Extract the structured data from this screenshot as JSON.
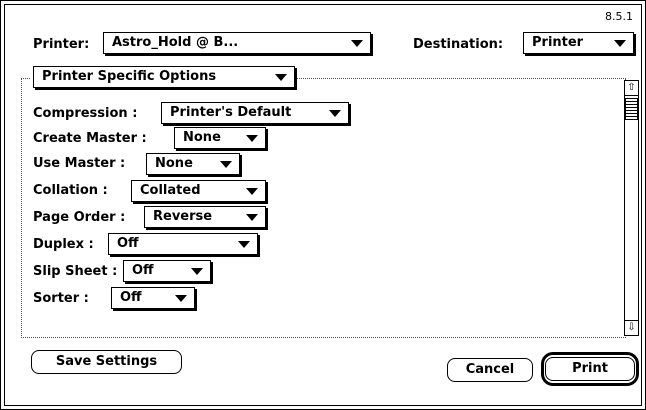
{
  "version": "8.5.1",
  "header": {
    "printer_label": "Printer:",
    "printer_value": "Astro_Hold @ B...",
    "destination_label": "Destination:",
    "destination_value": "Printer"
  },
  "group": {
    "title": "Printer Specific Options"
  },
  "options": [
    {
      "label": "Compression :",
      "value": "Printer's Default"
    },
    {
      "label": "Create Master :",
      "value": "None"
    },
    {
      "label": "Use Master :",
      "value": "None"
    },
    {
      "label": "Collation :",
      "value": "Collated"
    },
    {
      "label": "Page Order :",
      "value": "Reverse"
    },
    {
      "label": "Duplex :",
      "value": "Off"
    },
    {
      "label": "Slip Sheet :",
      "value": "Off"
    },
    {
      "label": "Sorter :",
      "value": "Off"
    }
  ],
  "buttons": {
    "save_settings": "Save Settings",
    "cancel": "Cancel",
    "print": "Print"
  }
}
